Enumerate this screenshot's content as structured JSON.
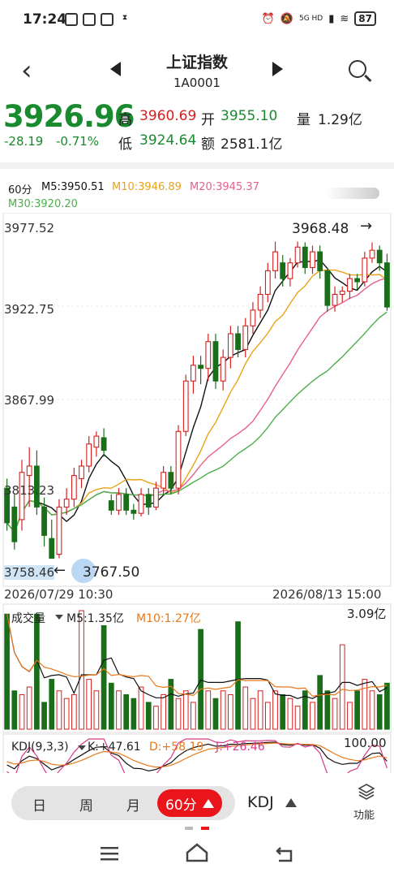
{
  "status_bar": {
    "time": "17:24",
    "network": "5G HD",
    "battery": "87"
  },
  "header": {
    "title": "上证指数",
    "code": "1A0001"
  },
  "quote": {
    "price": "3926.96",
    "change": "-28.19",
    "change_pct": "-0.71%",
    "high_label": "高",
    "high": "3960.69",
    "open_label": "开",
    "open": "3955.10",
    "volume_label": "量",
    "volume": "1.29亿",
    "low_label": "低",
    "low": "3924.64",
    "amount_label": "额",
    "amount": "2581.1亿"
  },
  "ma_legend": {
    "period": "60分",
    "m5": "M5:3950.51",
    "m10": "M10:3946.89",
    "m20": "M20:3945.37",
    "m30": "M30:3920.20"
  },
  "colors": {
    "up": "#d62020",
    "down": "#1a6e1a",
    "m5": "#111111",
    "m10": "#e8a317",
    "m20": "#e8608a",
    "m30": "#4cae4c",
    "accent": "#e9151b"
  },
  "chart_data": {
    "type": "candlestick",
    "y_ticks": [
      "3977.52",
      "3922.75",
      "3867.99",
      "3813.23",
      "3758.46"
    ],
    "ylim": [
      3758.46,
      3977.52
    ],
    "x_start_label": "2026/07/29 10:30",
    "x_end_label": "2026/08/13 15:00",
    "max_marker": "3968.48",
    "min_marker": "3767.50",
    "candles": [
      {
        "o": 3812,
        "c": 3790,
        "h": 3818,
        "l": 3785
      },
      {
        "o": 3800,
        "c": 3778,
        "h": 3808,
        "l": 3773
      },
      {
        "o": 3792,
        "c": 3822,
        "h": 3830,
        "l": 3785
      },
      {
        "o": 3820,
        "c": 3826,
        "h": 3838,
        "l": 3800
      },
      {
        "o": 3826,
        "c": 3800,
        "h": 3836,
        "l": 3795
      },
      {
        "o": 3800,
        "c": 3782,
        "h": 3806,
        "l": 3775
      },
      {
        "o": 3780,
        "c": 3767.5,
        "h": 3792,
        "l": 3767.5
      },
      {
        "o": 3770,
        "c": 3800,
        "h": 3805,
        "l": 3767.5
      },
      {
        "o": 3800,
        "c": 3805,
        "h": 3812,
        "l": 3795
      },
      {
        "o": 3805,
        "c": 3820,
        "h": 3825,
        "l": 3800
      },
      {
        "o": 3818,
        "c": 3826,
        "h": 3830,
        "l": 3812
      },
      {
        "o": 3826,
        "c": 3840,
        "h": 3845,
        "l": 3822
      },
      {
        "o": 3838,
        "c": 3845,
        "h": 3848,
        "l": 3832
      },
      {
        "o": 3844,
        "c": 3836,
        "h": 3850,
        "l": 3832
      },
      {
        "o": 3804,
        "c": 3798,
        "h": 3808,
        "l": 3795
      },
      {
        "o": 3798,
        "c": 3808,
        "h": 3812,
        "l": 3795
      },
      {
        "o": 3808,
        "c": 3798,
        "h": 3812,
        "l": 3795
      },
      {
        "o": 3798,
        "c": 3796,
        "h": 3802,
        "l": 3792
      },
      {
        "o": 3796,
        "c": 3808,
        "h": 3812,
        "l": 3794
      },
      {
        "o": 3808,
        "c": 3800,
        "h": 3812,
        "l": 3795
      },
      {
        "o": 3800,
        "c": 3812,
        "h": 3816,
        "l": 3798
      },
      {
        "o": 3812,
        "c": 3822,
        "h": 3826,
        "l": 3808
      },
      {
        "o": 3822,
        "c": 3812,
        "h": 3826,
        "l": 3808
      },
      {
        "o": 3812,
        "c": 3848,
        "h": 3852,
        "l": 3808
      },
      {
        "o": 3848,
        "c": 3880,
        "h": 3884,
        "l": 3845
      },
      {
        "o": 3880,
        "c": 3890,
        "h": 3896,
        "l": 3872
      },
      {
        "o": 3890,
        "c": 3888,
        "h": 3896,
        "l": 3878
      },
      {
        "o": 3888,
        "c": 3905,
        "h": 3910,
        "l": 3880
      },
      {
        "o": 3905,
        "c": 3880,
        "h": 3910,
        "l": 3875
      },
      {
        "o": 3880,
        "c": 3895,
        "h": 3900,
        "l": 3874
      },
      {
        "o": 3895,
        "c": 3910,
        "h": 3915,
        "l": 3888
      },
      {
        "o": 3910,
        "c": 3900,
        "h": 3915,
        "l": 3895
      },
      {
        "o": 3900,
        "c": 3915,
        "h": 3920,
        "l": 3895
      },
      {
        "o": 3915,
        "c": 3925,
        "h": 3930,
        "l": 3910
      },
      {
        "o": 3925,
        "c": 3935,
        "h": 3940,
        "l": 3920
      },
      {
        "o": 3935,
        "c": 3950,
        "h": 3955,
        "l": 3930
      },
      {
        "o": 3950,
        "c": 3962,
        "h": 3968.48,
        "l": 3945
      },
      {
        "o": 3955,
        "c": 3945,
        "h": 3960,
        "l": 3940
      },
      {
        "o": 3945,
        "c": 3955,
        "h": 3958,
        "l": 3940
      },
      {
        "o": 3955,
        "c": 3965,
        "h": 3968.48,
        "l": 3952
      },
      {
        "o": 3965,
        "c": 3952,
        "h": 3968,
        "l": 3948
      },
      {
        "o": 3952,
        "c": 3962,
        "h": 3966,
        "l": 3948
      },
      {
        "o": 3962,
        "c": 3950,
        "h": 3966,
        "l": 3945
      },
      {
        "o": 3950,
        "c": 3928,
        "h": 3952,
        "l": 3924
      },
      {
        "o": 3928,
        "c": 3935,
        "h": 3940,
        "l": 3924
      },
      {
        "o": 3935,
        "c": 3937,
        "h": 3940,
        "l": 3930
      },
      {
        "o": 3937,
        "c": 3945,
        "h": 3948,
        "l": 3932
      },
      {
        "o": 3945,
        "c": 3943,
        "h": 3948,
        "l": 3938
      },
      {
        "o": 3943,
        "c": 3958,
        "h": 3962,
        "l": 3940
      },
      {
        "o": 3958,
        "c": 3963,
        "h": 3968,
        "l": 3955
      },
      {
        "o": 3963,
        "c": 3955,
        "h": 3966,
        "l": 3950
      },
      {
        "o": 3955,
        "c": 3926.96,
        "h": 3960.69,
        "l": 3924.64
      }
    ]
  },
  "volume_panel": {
    "label": "成交量",
    "m5": "M5:1.35亿",
    "m10": "M10:1.27亿",
    "max_label": "3.09亿",
    "bars": [
      3.0,
      1.0,
      0.9,
      1.1,
      3.0,
      0.7,
      1.3,
      1.0,
      0.8,
      0.9,
      3.09,
      1.3,
      1.0,
      2.7,
      1.2,
      1.0,
      0.9,
      0.8,
      1.1,
      0.7,
      0.6,
      0.9,
      1.3,
      0.8,
      1.0,
      0.7,
      2.6,
      1.0,
      0.8,
      1.0,
      0.9,
      2.8,
      1.1,
      0.8,
      1.0,
      0.7,
      1.0,
      0.9,
      0.8,
      0.6,
      1.0,
      0.7,
      1.4,
      1.0,
      0.8,
      2.2,
      0.7,
      1.0,
      1.3,
      1.0,
      0.9,
      1.2
    ]
  },
  "kdj_panel": {
    "label": "KDJ(9,3,3)",
    "k": "K:+47.61",
    "d": "D:+58.19",
    "j": "J:+26.46",
    "max_label": "100.00"
  },
  "tabs": {
    "day": "日",
    "week": "周",
    "month": "月",
    "active": "60分",
    "indicator": "KDJ",
    "func": "功能"
  }
}
